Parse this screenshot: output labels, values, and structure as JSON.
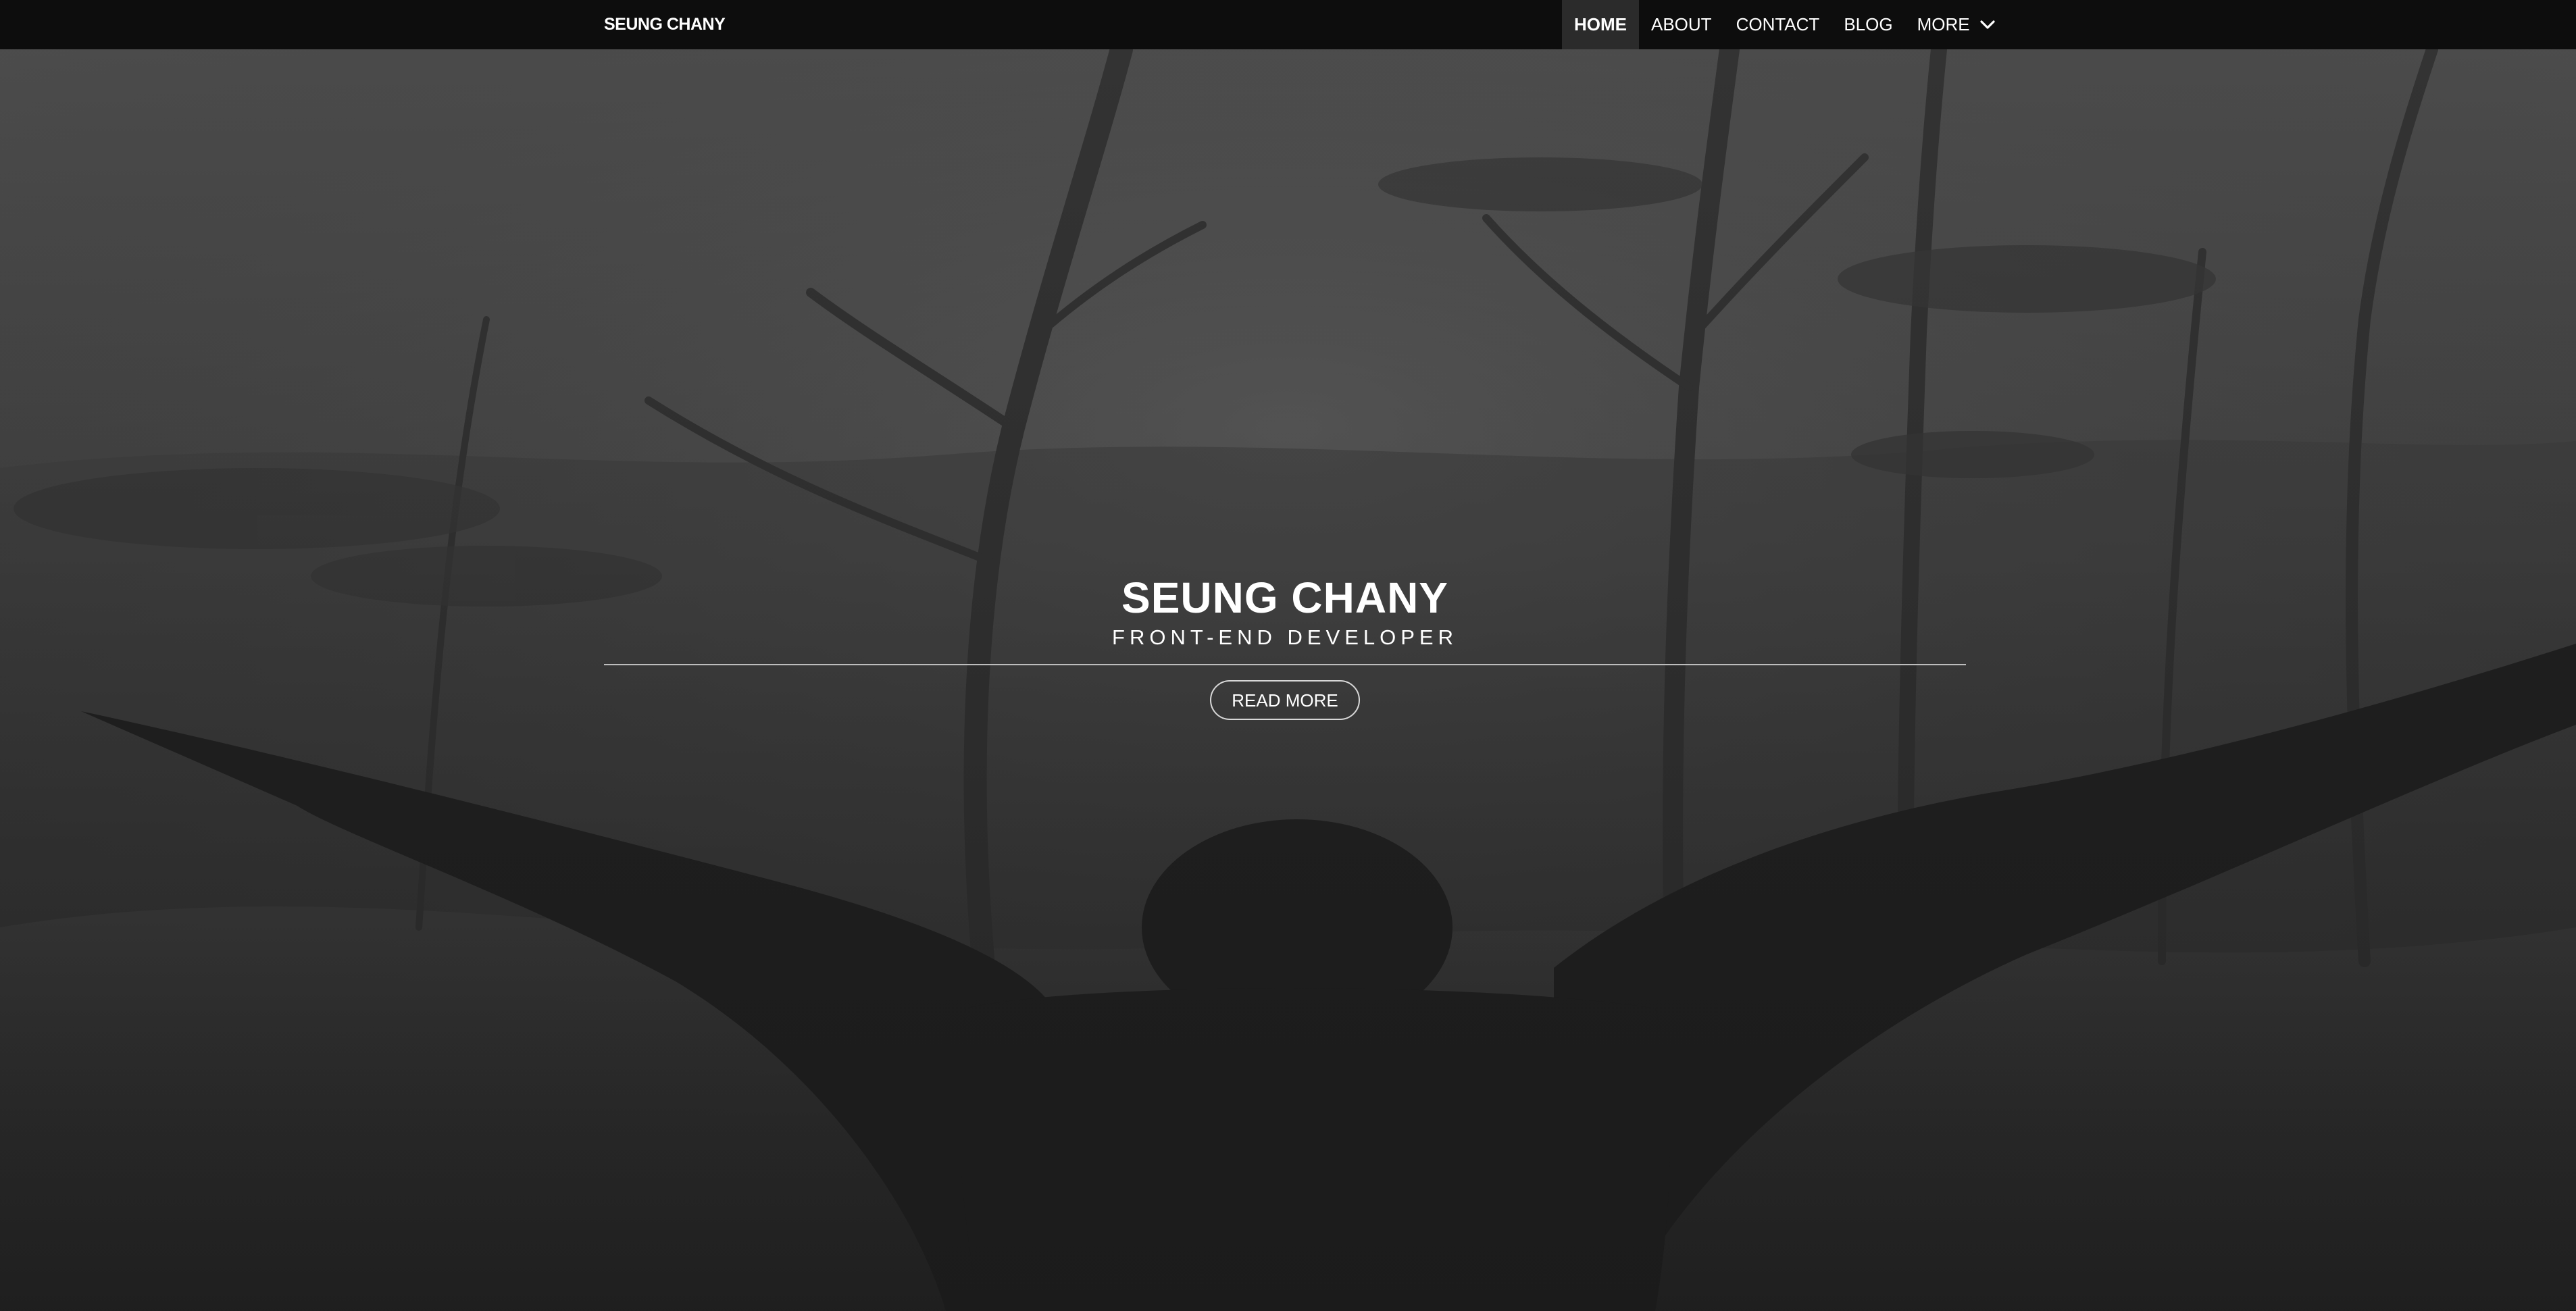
{
  "nav": {
    "brand": "SEUNG CHANY",
    "items": [
      {
        "label": "HOME",
        "active": true
      },
      {
        "label": "ABOUT",
        "active": false
      },
      {
        "label": "CONTACT",
        "active": false
      },
      {
        "label": "BLOG",
        "active": false
      },
      {
        "label": "MORE",
        "active": false,
        "has_dropdown": true
      }
    ],
    "more_icon": "chevron-down-icon"
  },
  "hero": {
    "title": "SEUNG CHANY",
    "subtitle": "FRONT-END DEVELOPER",
    "button_label": "READ MORE",
    "background": "grayscale photo: person with outstretched arms facing forest on hilltop"
  },
  "colors": {
    "navbar_bg": "#0d0d0d",
    "active_tab_bg": "#2b2b2b",
    "text": "#ffffff",
    "divider": "#bdbdbd"
  }
}
